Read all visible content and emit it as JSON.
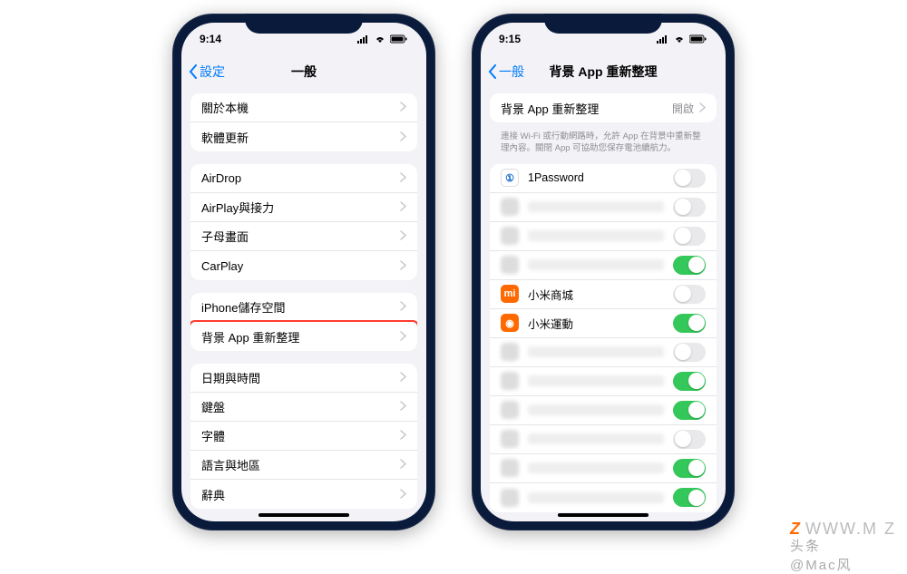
{
  "status": {
    "time_left": "9:14",
    "time_right": "9:15"
  },
  "watermark": {
    "z": "Z",
    "url": "WWW.M  Z",
    "credit": "头条@Mac风"
  },
  "phone_left": {
    "back": "設定",
    "title": "一般",
    "group1": [
      {
        "label": "關於本機"
      },
      {
        "label": "軟體更新"
      }
    ],
    "group2": [
      {
        "label": "AirDrop"
      },
      {
        "label": "AirPlay與接力"
      },
      {
        "label": "子母畫面"
      },
      {
        "label": "CarPlay"
      }
    ],
    "group3": [
      {
        "label": "iPhone儲存空間"
      },
      {
        "label": "背景 App 重新整理",
        "highlighted": true
      }
    ],
    "group4": [
      {
        "label": "日期與時間"
      },
      {
        "label": "鍵盤"
      },
      {
        "label": "字體"
      },
      {
        "label": "語言與地區"
      },
      {
        "label": "辭典"
      }
    ]
  },
  "phone_right": {
    "back": "一般",
    "title": "背景 App 重新整理",
    "setting_row": {
      "label": "背景 App 重新整理",
      "value": "開啟"
    },
    "footer": "連接 Wi-Fi 或行動網路時，允許 App 在背景中重新整理內容。關閉 App 可協助您保存電池續航力。",
    "apps": [
      {
        "name": "1Password",
        "icon_bg": "#fff",
        "icon_txt": "①",
        "icon_color": "#0a63c8",
        "on": false,
        "blurred": false
      },
      {
        "name": "",
        "on": false,
        "blurred": true
      },
      {
        "name": "",
        "on": false,
        "blurred": true
      },
      {
        "name": "",
        "on": true,
        "blurred": true
      },
      {
        "name": "小米商城",
        "icon_bg": "#ff6900",
        "icon_txt": "mi",
        "icon_color": "#fff",
        "on": false,
        "blurred": false
      },
      {
        "name": "小米運動",
        "icon_bg": "#ff6900",
        "icon_txt": "◉",
        "icon_color": "#fff",
        "on": true,
        "blurred": false
      },
      {
        "name": "",
        "on": false,
        "blurred": true
      },
      {
        "name": "",
        "on": true,
        "blurred": true
      },
      {
        "name": "",
        "on": true,
        "blurred": true
      },
      {
        "name": "",
        "on": false,
        "blurred": true
      },
      {
        "name": "",
        "on": true,
        "blurred": true
      },
      {
        "name": "",
        "on": true,
        "blurred": true
      }
    ]
  }
}
